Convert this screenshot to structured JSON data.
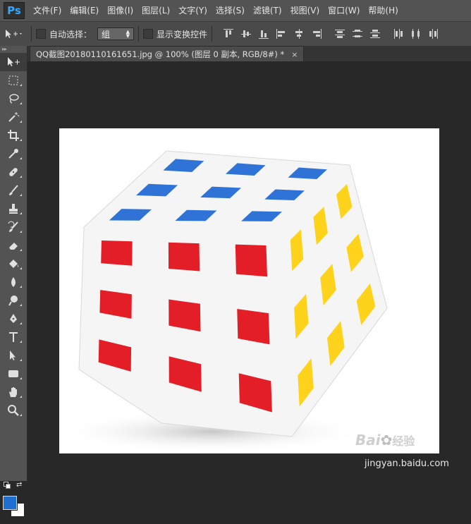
{
  "app": {
    "logo": "Ps",
    "menu": [
      "文件(F)",
      "编辑(E)",
      "图像(I)",
      "图层(L)",
      "文字(Y)",
      "选择(S)",
      "滤镜(T)",
      "视图(V)",
      "窗口(W)",
      "帮助(H)"
    ]
  },
  "options": {
    "auto_select_label": "自动选择：",
    "auto_select_value": "组",
    "show_transform_label": "显示变换控件"
  },
  "document": {
    "tab_title": "QQ截图20180110161651.jpg @ 100% (图层 0 副本, RGB/8#) *",
    "close_glyph": "×"
  },
  "tools": [
    "move-icon",
    "marquee-icon",
    "lasso-icon",
    "magic-wand-icon",
    "crop-icon",
    "eyedropper-icon",
    "healing-brush-icon",
    "brush-icon",
    "clone-stamp-icon",
    "history-brush-icon",
    "eraser-icon",
    "paint-bucket-icon",
    "blur-icon",
    "dodge-icon",
    "pen-icon",
    "type-icon",
    "path-selection-icon",
    "shape-icon",
    "hand-icon",
    "zoom-icon"
  ],
  "colors": {
    "foreground": "#1f6fd0",
    "background": "#ffffff",
    "cube_blue": "#2f73d6",
    "cube_red": "#e41e26",
    "cube_yellow": "#ffd21c"
  },
  "watermark": {
    "brand": "Bai",
    "brand_suffix": "经验",
    "url": "jingyan.baidu.com"
  }
}
